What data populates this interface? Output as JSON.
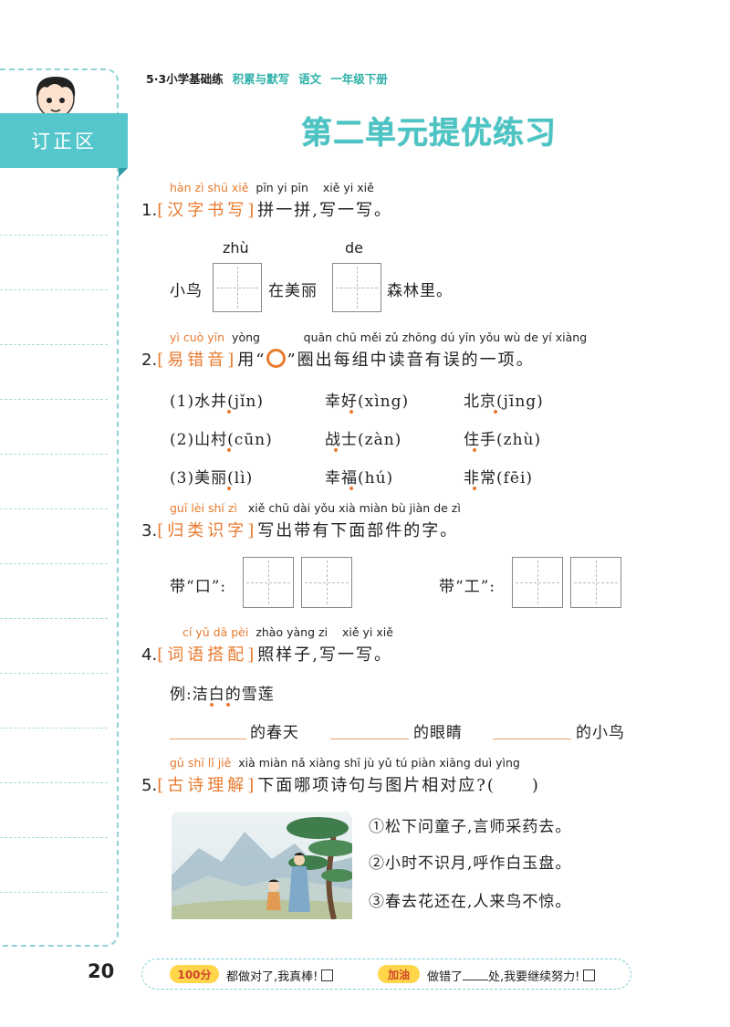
{
  "header": {
    "series": "5·3小学基础练",
    "book": "积累与默写",
    "subject": "语文",
    "grade": "一年级下册"
  },
  "title": "第二单元提优练习",
  "correction_tab": "订正区",
  "page_number": "20",
  "q1": {
    "pinyin": [
      "hàn",
      "zì",
      "shū",
      "xiě",
      "pīn",
      "yi",
      "pīn",
      "xiě",
      "yi",
      "xiě"
    ],
    "num": "1.",
    "tag": "[汉字书写]",
    "text": "拼一拼,写一写。",
    "box_pinyin": [
      "zhù",
      "de"
    ],
    "seg1": "小鸟",
    "seg2": "在美丽",
    "seg3": "森林里。"
  },
  "q2": {
    "pinyin": [
      "yì",
      "cuò",
      "yīn",
      "yòng",
      "quān",
      "chū",
      "měi",
      "zǔ",
      "zhōng",
      "dú",
      "yīn",
      "yǒu",
      "wù",
      "de",
      "yí",
      "xiàng"
    ],
    "num": "2.",
    "tag": "[易错音]",
    "text_a": "用“",
    "text_b": "”圈出每组中读音有误的一项。",
    "rows": [
      [
        "(1)水井(jǐn)",
        "幸好(xìng)",
        "北京(jīng)"
      ],
      [
        "(2)山村(cūn)",
        "战士(zàn)",
        "住手(zhù)"
      ],
      [
        "(3)美丽(lì)",
        "幸福(hú)",
        "非常(fēi)"
      ]
    ]
  },
  "q3": {
    "pinyin": [
      "guī",
      "lèi",
      "shí",
      "zì",
      "xiě",
      "chū",
      "dài",
      "yǒu",
      "xià",
      "miàn",
      "bù",
      "jiàn",
      "de",
      "zì"
    ],
    "num": "3.",
    "tag": "[归类识字]",
    "text": "写出带有下面部件的字。",
    "left_label": "带“口”:",
    "right_label": "带“工”:"
  },
  "q4": {
    "pinyin": [
      "cí",
      "yǔ",
      "dā",
      "pèi",
      "zhào",
      "yàng",
      "zi",
      "xiě",
      "yi",
      "xiě"
    ],
    "num": "4.",
    "tag": "[词语搭配]",
    "text": "照样子,写一写。",
    "example": "例:洁白的雪莲",
    "blanks": [
      "的春天",
      "的眼睛",
      "的小鸟"
    ]
  },
  "q5": {
    "pinyin": [
      "gǔ",
      "shī",
      "lǐ",
      "jiě",
      "xià",
      "miàn",
      "nǎ",
      "xiàng",
      "shī",
      "jù",
      "yǔ",
      "tú",
      "piàn",
      "xiāng",
      "duì",
      "yìng"
    ],
    "num": "5.",
    "tag": "[古诗理解]",
    "text": "下面哪项诗句与图片相对应?(　　)",
    "options": [
      "①松下问童子,言师采药去。",
      "②小时不识月,呼作白玉盘。",
      "③春去花还在,人来鸟不惊。"
    ]
  },
  "footer": {
    "badge_left": "100分",
    "left_text": "都做对了,我真棒!",
    "badge_right": "加油",
    "right_text_a": "做错了",
    "right_text_b": "处,我要继续努力!"
  },
  "colors": {
    "accent_teal": "#55c6cb",
    "accent_orange": "#e87a2e"
  }
}
